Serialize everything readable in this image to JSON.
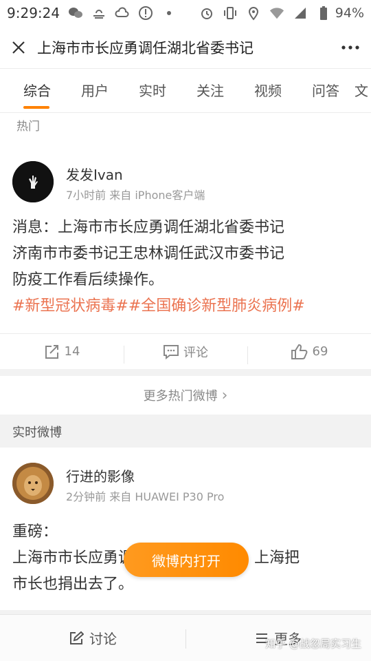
{
  "status_bar": {
    "time": "9:29:24",
    "battery": "94%",
    "icons": [
      "wechat-icon",
      "weather-icon",
      "cloud-icon",
      "alert-icon",
      "dot-icon",
      "alarm-icon",
      "vibrate-icon",
      "location-icon",
      "wifi-icon",
      "signal-icon",
      "battery-icon"
    ]
  },
  "title_bar": {
    "title": "上海市市长应勇调任湖北省委书记"
  },
  "tabs": [
    {
      "label": "综合",
      "active": true
    },
    {
      "label": "用户",
      "active": false
    },
    {
      "label": "实时",
      "active": false
    },
    {
      "label": "关注",
      "active": false
    },
    {
      "label": "视频",
      "active": false
    },
    {
      "label": "问答",
      "active": false
    },
    {
      "label": "文",
      "active": false
    }
  ],
  "hot_section": {
    "label": "热门"
  },
  "post1": {
    "username": "发发Ivan",
    "meta": "7小时前 来自 iPhone客户端",
    "lines": [
      "消息：上海市市长应勇调任湖北省委书记",
      "济南市市委书记王忠林调任武汉市委书记",
      "防疫工作看后续操作。"
    ],
    "hashtags": "#新型冠状病毒##全国确诊新型肺炎病例#",
    "repost_count": "14",
    "comment_label": "评论",
    "like_count": "69"
  },
  "more_hot": {
    "label": "更多热门微博",
    "arrow": "›"
  },
  "realtime_section": {
    "label": "实时微博"
  },
  "post2": {
    "username": "行进的影像",
    "meta": "2分钟前 来自 HUAWEI P30 Pro",
    "lines": [
      "重磅：",
      "上海市市长应勇调任湖北省委书记！上海把",
      "市长也捐出去了。"
    ]
  },
  "open_app": {
    "label": "微博内打开"
  },
  "bottom_bar": {
    "discuss": "讨论",
    "more": "更多"
  },
  "watermark": "知乎 @战忽局实习生",
  "colors": {
    "accent": "#ff8200",
    "hashtag": "#eb7350"
  }
}
